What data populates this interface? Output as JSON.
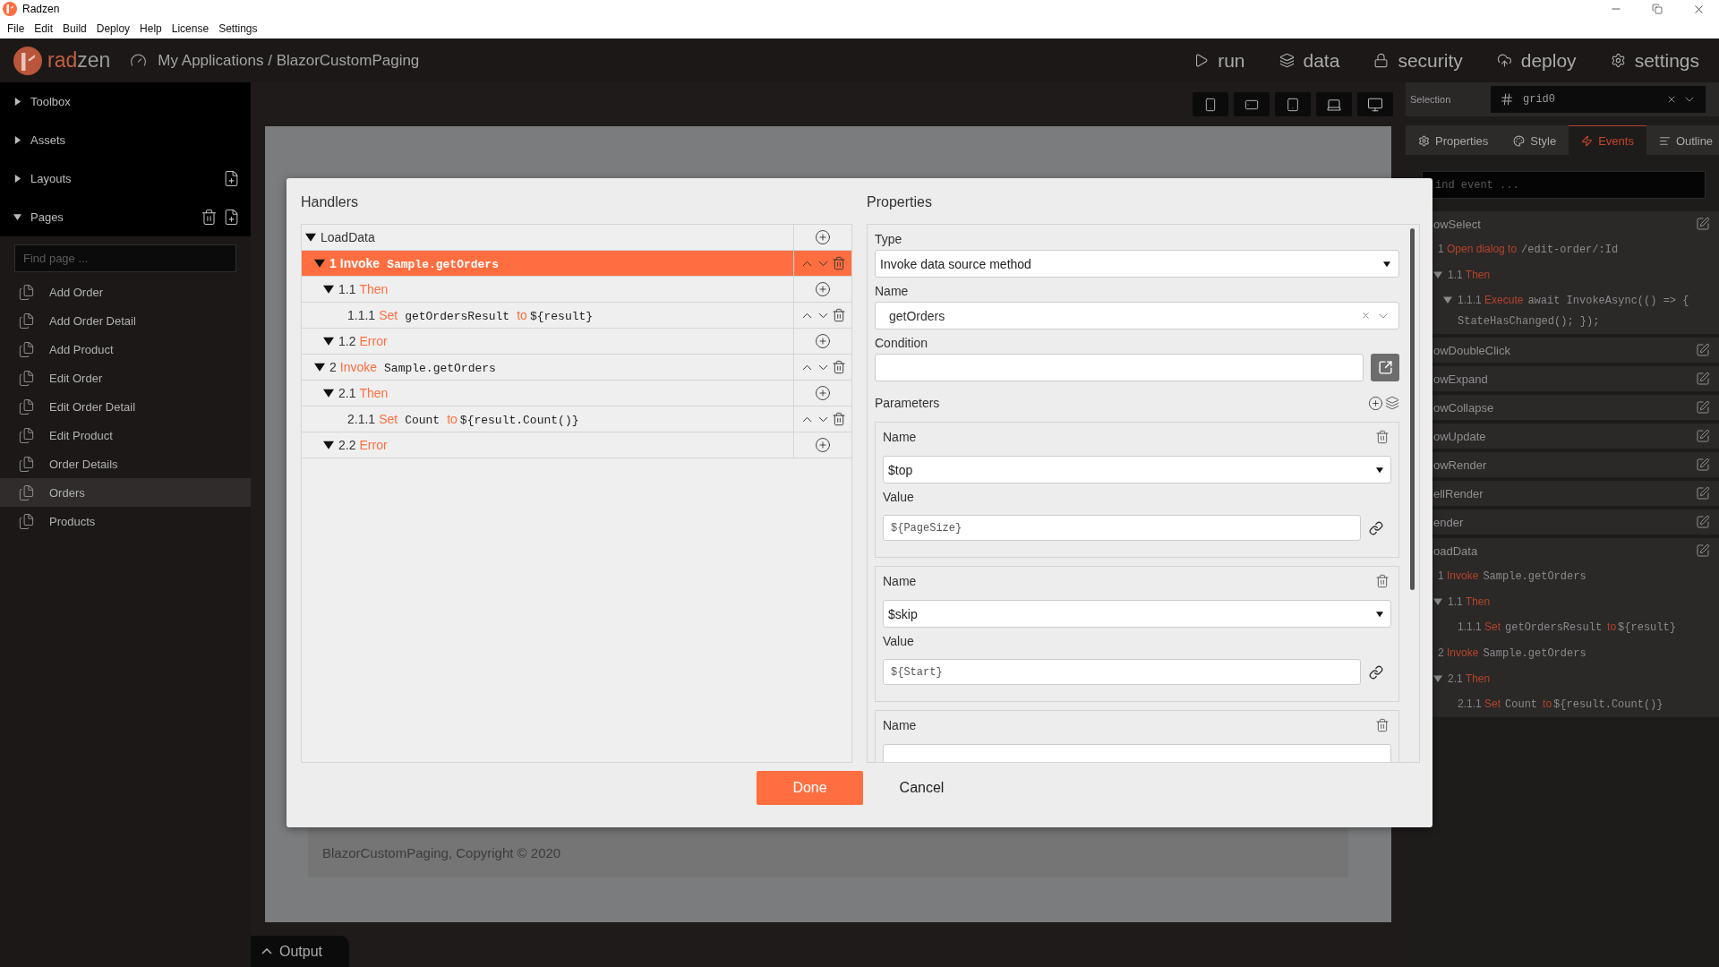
{
  "window": {
    "title": "Radzen"
  },
  "menu": [
    {
      "label": "File"
    },
    {
      "label": "Edit"
    },
    {
      "label": "Build"
    },
    {
      "label": "Deploy"
    },
    {
      "label": "Help"
    },
    {
      "label": "License"
    },
    {
      "label": "Settings"
    }
  ],
  "header": {
    "logo": {
      "accent": "rad",
      "rest": "zen"
    },
    "breadcrumb": "My Applications / BlazorCustomPaging",
    "nav": [
      {
        "kind": "run",
        "label": "run"
      },
      {
        "kind": "data",
        "label": "data"
      },
      {
        "kind": "security",
        "label": "security"
      },
      {
        "kind": "deploy",
        "label": "deploy"
      },
      {
        "kind": "settings",
        "label": "settings"
      }
    ]
  },
  "sidebar": {
    "sections": [
      {
        "label": "Toolbox",
        "expanded": false
      },
      {
        "label": "Assets",
        "expanded": false
      },
      {
        "label": "Layouts",
        "expanded": false,
        "actions": [
          {
            "kind": "add"
          }
        ]
      },
      {
        "label": "Pages",
        "expanded": true,
        "actions": [
          {
            "kind": "delete"
          },
          {
            "kind": "add"
          }
        ]
      }
    ],
    "pages": {
      "search": {
        "placeholder": "Find page ..."
      },
      "items": [
        {
          "label": "Add Order",
          "selected": false
        },
        {
          "label": "Add Order Detail",
          "selected": false
        },
        {
          "label": "Add Product",
          "selected": false
        },
        {
          "label": "Edit Order",
          "selected": false
        },
        {
          "label": "Edit Order Detail",
          "selected": false
        },
        {
          "label": "Edit Product",
          "selected": false
        },
        {
          "label": "Order Details",
          "selected": false
        },
        {
          "label": "Orders",
          "selected": true
        },
        {
          "label": "Products",
          "selected": false
        }
      ]
    }
  },
  "canvas": {
    "footer": "BlazorCustomPaging, Copyright © 2020"
  },
  "output": {
    "label": "Output"
  },
  "inspector": {
    "selection": {
      "label": "Selection",
      "value": "grid0"
    },
    "tabs": [
      {
        "kind": "properties",
        "label": "Properties",
        "selected": false
      },
      {
        "kind": "style",
        "label": "Style",
        "selected": false
      },
      {
        "kind": "events",
        "label": "Events",
        "selected": true
      },
      {
        "kind": "outline",
        "label": "Outline",
        "selected": false
      }
    ],
    "search": {
      "placeholder": "ind event ..."
    },
    "events": [
      {
        "name": "owSelect",
        "children": [
          {
            "number": "1",
            "verb": "Open dialog to",
            "target": "/edit-order/:Id",
            "children": [
              {
                "number": "1.1",
                "verb": "Then",
                "expanded": true,
                "children": [
                  {
                    "number": "1.1.1",
                    "verb": "Execute",
                    "target": "await InvokeAsync(() => { StateHasChanged(); });",
                    "expanded": true
                  }
                ]
              }
            ]
          }
        ]
      },
      {
        "name": "owDoubleClick"
      },
      {
        "name": "owExpand"
      },
      {
        "name": "owCollapse"
      },
      {
        "name": "owUpdate"
      },
      {
        "name": "owRender"
      },
      {
        "name": "ellRender"
      },
      {
        "name": "ender"
      },
      {
        "name": "oadData",
        "children": [
          {
            "number": "1",
            "verb": "Invoke",
            "target": "Sample.getOrders",
            "children": [
              {
                "number": "1.1",
                "verb": "Then",
                "expanded": true,
                "children": [
                  {
                    "number": "1.1.1",
                    "verb": "Set",
                    "target": "getOrdersResult",
                    "link": "to",
                    "value": "${result}"
                  }
                ]
              }
            ]
          },
          {
            "number": "2",
            "verb": "Invoke",
            "target": "Sample.getOrders",
            "children": [
              {
                "number": "2.1",
                "verb": "Then",
                "expanded": true,
                "children": [
                  {
                    "number": "2.1.1",
                    "verb": "Set",
                    "target": "Count",
                    "link": "to",
                    "value": "${result.Count()}"
                  }
                ]
              }
            ]
          }
        ]
      }
    ]
  },
  "dialog": {
    "handlers": {
      "title": "Handlers",
      "root": {
        "kind": "event",
        "name": "LoadData",
        "expanded": true,
        "selected": false,
        "children": [
          {
            "kind": "action",
            "number": "1",
            "verb": "Invoke",
            "target": "Sample.getOrders",
            "expanded": true,
            "selected": true,
            "children": [
              {
                "kind": "branch",
                "number": "1.1",
                "verb": "Then",
                "expanded": true,
                "selected": false,
                "children": [
                  {
                    "kind": "action",
                    "number": "1.1.1",
                    "verb": "Set",
                    "target": "getOrdersResult",
                    "link": "to",
                    "value": "${result}",
                    "selected": false
                  }
                ]
              },
              {
                "kind": "branch",
                "number": "1.2",
                "verb": "Error",
                "expanded": true,
                "selected": false
              }
            ]
          },
          {
            "kind": "action",
            "number": "2",
            "verb": "Invoke",
            "target": "Sample.getOrders",
            "expanded": true,
            "selected": false,
            "children": [
              {
                "kind": "branch",
                "number": "2.1",
                "verb": "Then",
                "expanded": true,
                "selected": false,
                "children": [
                  {
                    "kind": "action",
                    "number": "2.1.1",
                    "verb": "Set",
                    "target": "Count",
                    "link": "to",
                    "value": "${result.Count()}",
                    "selected": false
                  }
                ]
              },
              {
                "kind": "branch",
                "number": "2.2",
                "verb": "Error",
                "expanded": true,
                "selected": false
              }
            ]
          }
        ]
      }
    },
    "properties": {
      "title": "Properties",
      "type": {
        "label": "Type",
        "value": "Invoke data source method"
      },
      "name": {
        "label": "Name",
        "value": "getOrders"
      },
      "condition": {
        "label": "Condition"
      },
      "parameters": {
        "title": "Parameters",
        "items": [
          {
            "name_label": "Name",
            "name": "$top",
            "value_label": "Value",
            "value": "${PageSize}"
          },
          {
            "name_label": "Name",
            "name": "$skip",
            "value_label": "Value",
            "value": "${Start}"
          },
          {
            "name_label": "Name"
          }
        ]
      }
    },
    "buttons": [
      {
        "kind": "primary",
        "label": "Done"
      },
      {
        "kind": "secondary",
        "label": "Cancel"
      }
    ]
  }
}
